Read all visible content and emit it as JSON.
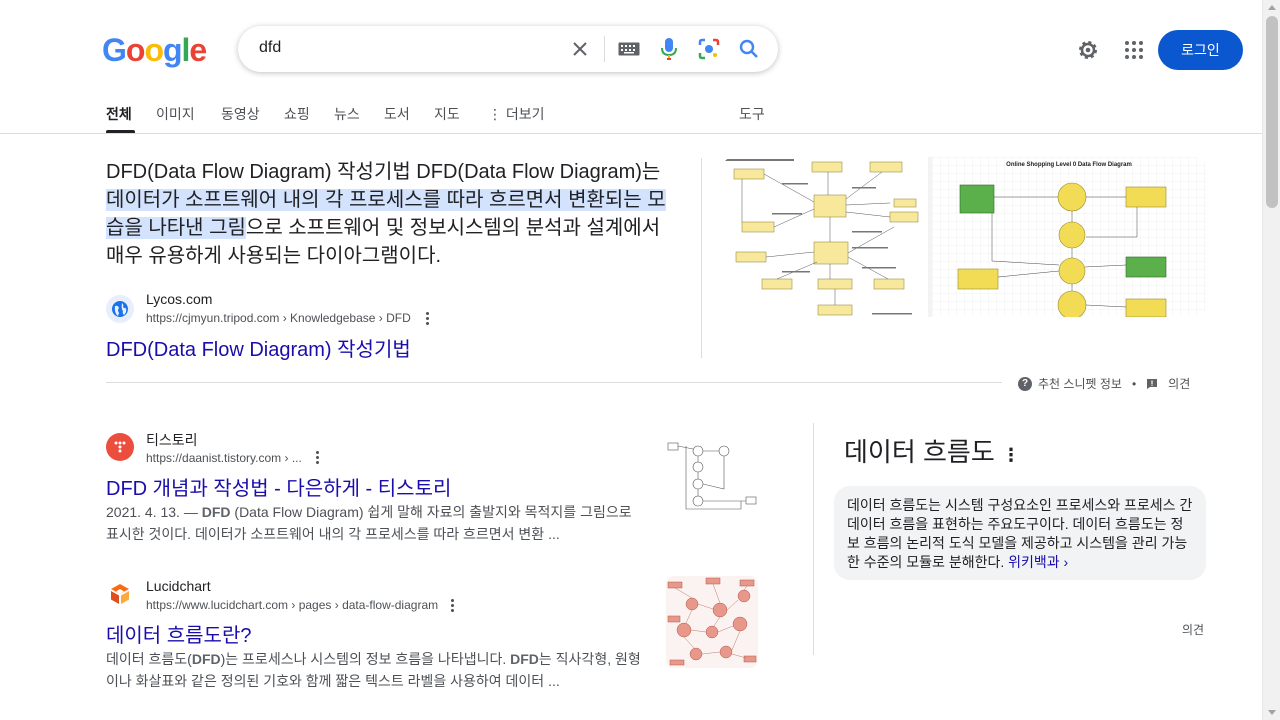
{
  "logo": {
    "letters": [
      "G",
      "o",
      "o",
      "g",
      "l",
      "e"
    ],
    "colors": [
      "#4285F4",
      "#EA4335",
      "#FBBC05",
      "#4285F4",
      "#34A853",
      "#EA4335"
    ]
  },
  "search": {
    "query": "dfd"
  },
  "header": {
    "login_label": "로그인"
  },
  "tabs": [
    {
      "label": "전체"
    },
    {
      "label": "이미지"
    },
    {
      "label": "동영상"
    },
    {
      "label": "쇼핑"
    },
    {
      "label": "뉴스"
    },
    {
      "label": "도서"
    },
    {
      "label": "지도"
    },
    {
      "label": "더보기"
    },
    {
      "label": "도구"
    }
  ],
  "featured": {
    "text_prefix": "DFD(Data Flow Diagram) 작성기법 DFD(Data Flow Diagram)는 ",
    "text_highlight": "데이터가 소프트웨어 내의 각 프로세스를 따라 흐르면서 변환되는 모습을 나타낸 그림",
    "text_suffix": "으로 소프트웨어 및 정보시스템의 분석과 설계에서 매우 유용하게 사용되는 다이아그램이다.",
    "site_name": "Lycos.com",
    "site_url": "https://cjmyun.tripod.com › Knowledgebase › DFD",
    "title": "DFD(Data Flow Diagram) 작성기법",
    "image_title": "Online Shopping Level 0 Data Flow Diagram",
    "about_label": "추천 스니펫 정보",
    "feedback_label": "의견"
  },
  "results": [
    {
      "site_name": "티스토리",
      "site_url": "https://daanist.tistory.com › ...",
      "title": "DFD 개념과 작성법 - 다은하게 - 티스토리",
      "date": "2021. 4. 13. — ",
      "snippet_b1": "DFD",
      "snippet_1": " (Data Flow Diagram) 쉽게 말해 자료의 출발지와 목적지를 그림으로 표시한 것이다. 데이터가 소프트웨어 내의 각 프로세스를 따라 흐르면서 변환 ..."
    },
    {
      "site_name": "Lucidchart",
      "site_url": "https://www.lucidchart.com › pages › data-flow-diagram",
      "title": "데이터 흐름도란?",
      "snippet_a": "데이터 흐름도(",
      "snippet_b1": "DFD",
      "snippet_b": ")는 프로세스나 시스템의 정보 흐름을 나타냅니다. ",
      "snippet_b2": "DFD",
      "snippet_c": "는 직사각형, 원형이나 화살표와 같은 정의된 기호와 함께 짧은 텍스트 라벨을 사용하여 데이터 ..."
    }
  ],
  "knowledge_panel": {
    "title": "데이터 흐름도",
    "description": "데이터 흐름도는 시스템 구성요소인 프로세스와 프로세스 간 데이터 흐름을 표현하는 주요도구이다. 데이터 흐름도는 정보 흐름의 논리적 도식 모델을 제공하고 시스템을 관리 가능한 수준의 모듈로 분해한다. ",
    "source_link": "위키백과 ›",
    "feedback_label": "의견"
  }
}
